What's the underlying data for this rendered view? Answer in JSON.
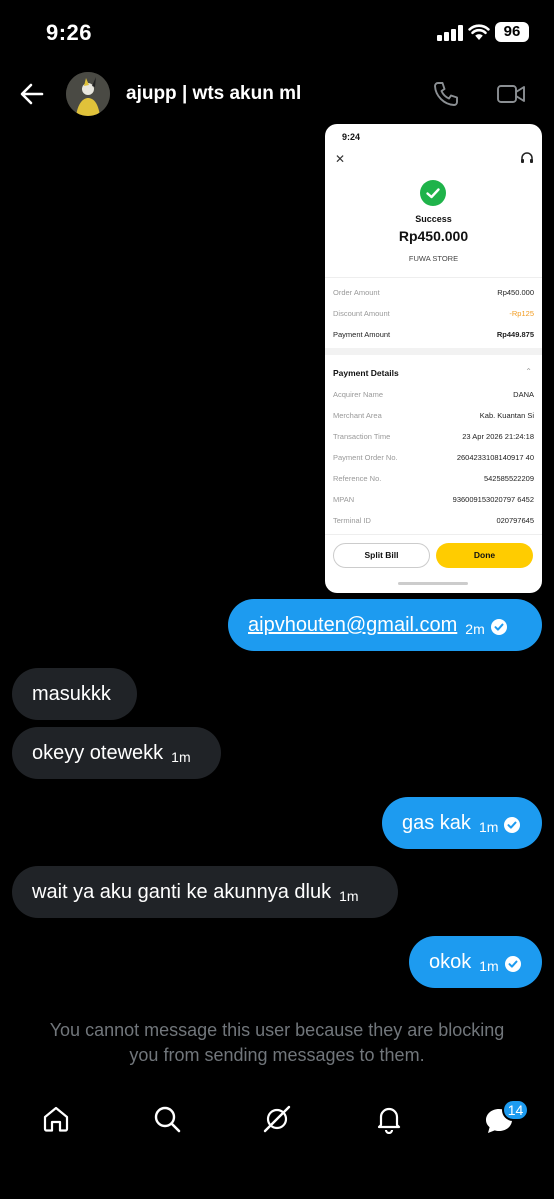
{
  "status_bar": {
    "time": "9:26",
    "battery": "96"
  },
  "header": {
    "username": "ajupp | wts akun ml"
  },
  "shared_screenshot": {
    "status_time": "9:24",
    "close": "✕",
    "title": "Success",
    "amount": "Rp450.000",
    "store": "FUWA STORE",
    "summary": [
      {
        "label": "Order Amount",
        "value": "Rp450.000"
      },
      {
        "label": "Discount Amount",
        "value": "-Rp125"
      },
      {
        "label": "Payment Amount",
        "value": "Rp449.875"
      }
    ],
    "details_header": "Payment Details",
    "details": [
      {
        "label": "Acquirer Name",
        "value": "DANA"
      },
      {
        "label": "Merchant Area",
        "value": "Kab. Kuantan Si"
      },
      {
        "label": "Transaction Time",
        "value": "23 Apr 2026 21:24:18"
      },
      {
        "label": "Payment Order No.",
        "value": "2604233108140917 40"
      },
      {
        "label": "Reference No.",
        "value": "542585522209"
      },
      {
        "label": "MPAN",
        "value": "936009153020797 6452"
      },
      {
        "label": "Terminal ID",
        "value": "020797645"
      }
    ],
    "split_bill": "Split Bill",
    "done": "Done"
  },
  "messages": [
    {
      "text": "aipvhouten@gmail.com",
      "time": "2m",
      "sent": true
    },
    {
      "text": "masukkk",
      "time": "",
      "sent": false
    },
    {
      "text": "okeyy otewekk",
      "time": "1m",
      "sent": false
    },
    {
      "text": "gas kak",
      "time": "1m",
      "sent": true
    },
    {
      "text": "wait ya aku ganti ke akunnya dluk",
      "time": "1m",
      "sent": false
    },
    {
      "text": "okok",
      "time": "1m",
      "sent": true
    }
  ],
  "blocked_notice": {
    "line1": "You cannot message this user because they are blocking",
    "line2": "you from sending messages to them."
  },
  "nav": {
    "messages_badge": "14"
  },
  "colors": {
    "accent": "#1d9bf0",
    "received_bubble": "#202327",
    "muted_text": "#71767b",
    "success_green": "#1fb34a",
    "done_yellow": "#ffcc00"
  }
}
